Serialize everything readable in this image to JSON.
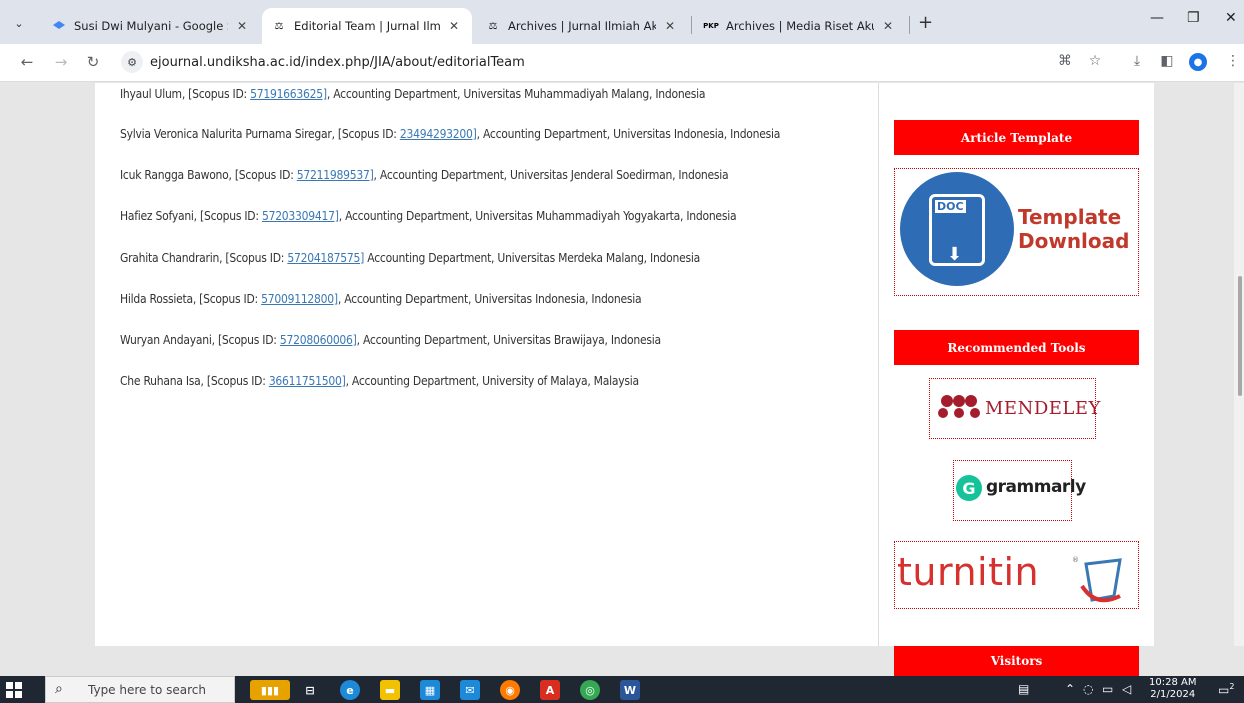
{
  "browser": {
    "tabs": [
      {
        "title": "Susi Dwi Mulyani - Google Scho",
        "favicon": "scholar-cap-icon",
        "active": false
      },
      {
        "title": "Editorial Team | Jurnal Ilmiah Ak",
        "favicon": "scales-icon",
        "active": true
      },
      {
        "title": "Archives | Jurnal Ilmiah Akuntan",
        "favicon": "scales-icon",
        "active": false
      },
      {
        "title": "Archives | Media Riset Akuntans",
        "favicon": "pkp-icon",
        "active": false
      }
    ],
    "favicon_pkp_text": "PKP",
    "url": "ejournal.undiksha.ac.id/index.php/JIA/about/editorialTeam"
  },
  "editors": [
    {
      "prefix": "Ihyaul Ulum, [Scopus ID: ",
      "scopus_id": "57191663625]",
      "suffix": ", Accounting Department, Universitas Muhammadiyah Malang, Indonesia"
    },
    {
      "prefix": "Sylvia Veronica Nalurita Purnama Siregar, [Scopus ID: ",
      "scopus_id": "23494293200]",
      "suffix": ", Accounting Department, Universitas Indonesia, Indonesia"
    },
    {
      "prefix": "Icuk Rangga Bawono, [Scopus ID: ",
      "scopus_id": "57211989537]",
      "suffix": ", Accounting Department, Universitas Jenderal Soedirman, Indonesia"
    },
    {
      "prefix": "Hafiez Sofyani, [Scopus ID: ",
      "scopus_id": "57203309417]",
      "suffix": ", Accounting Department, Universitas Muhammadiyah Yogyakarta, Indonesia"
    },
    {
      "prefix": "Grahita Chandrarin, [Scopus ID: ",
      "scopus_id": "57204187575]",
      "suffix": " Accounting Department, Universitas Merdeka Malang, Indonesia"
    },
    {
      "prefix": "Hilda Rossieta, [Scopus ID: ",
      "scopus_id": "57009112800]",
      "suffix": ", Accounting Department, Universitas Indonesia, Indonesia"
    },
    {
      "prefix": "Wuryan Andayani, [Scopus ID: ",
      "scopus_id": "57208060006]",
      "suffix": ", Accounting Department, Universitas Brawijaya, Indonesia"
    },
    {
      "prefix": "Che Ruhana Isa, [Scopus ID: ",
      "scopus_id": "36611751500]",
      "suffix": ", Accounting Department, University of Malaya, Malaysia"
    }
  ],
  "sidebar": {
    "article_template_header": "Article Template",
    "template_doc_label": "DOC",
    "template_line1": "Template",
    "template_line2": "Download",
    "recommended_tools_header": "Recommended Tools",
    "mendeley_label": "MENDELEY",
    "grammarly_letter": "G",
    "grammarly_label": "grammarly",
    "turnitin_label": "turnitin",
    "turnitin_reg": "®",
    "visitors_header": "Visitors"
  },
  "taskbar": {
    "search_placeholder": "Type here to search",
    "time": "10:28 AM",
    "date": "2/1/2024",
    "notification_count": "2"
  },
  "colors": {
    "accent_red": "#ff0000",
    "link_blue": "#3a78b5",
    "template_blue": "#2e6db5"
  }
}
